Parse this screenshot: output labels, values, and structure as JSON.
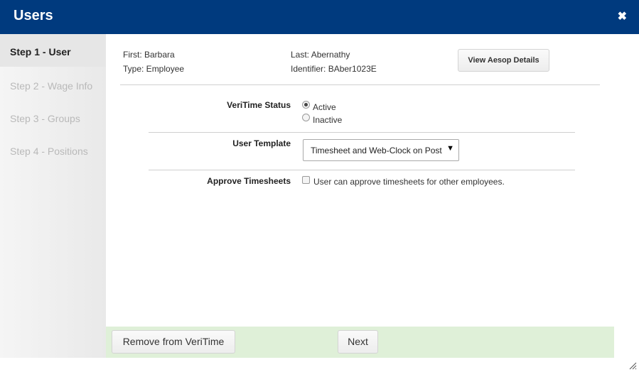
{
  "dialog": {
    "title": "Users",
    "close_icon": "close-icon",
    "close_glyph": "✖"
  },
  "steps": [
    {
      "label": "Step 1 - User",
      "active": true
    },
    {
      "label": "Step 2 - Wage Info",
      "active": false
    },
    {
      "label": "Step 3 - Groups",
      "active": false
    },
    {
      "label": "Step 4 - Positions",
      "active": false
    }
  ],
  "user_info": {
    "first": "First: Barbara",
    "last": "Last: Abernathy",
    "type": "Type: Employee",
    "identifier": "Identifier: BAber1023E"
  },
  "buttons": {
    "view_aesop": "View Aesop Details",
    "remove": "Remove from VeriTime",
    "next": "Next"
  },
  "form": {
    "veritime_status": {
      "label": "VeriTime Status",
      "options": [
        {
          "label": "Active",
          "selected": true
        },
        {
          "label": "Inactive",
          "selected": false
        }
      ]
    },
    "user_template": {
      "label": "User Template",
      "selected": "Timesheet and Web-Clock on Post",
      "arrow": "▼"
    },
    "approve_timesheets": {
      "label": "Approve Timesheets",
      "checkbox_label": "User can approve timesheets for other employees.",
      "checked": false
    }
  },
  "colors": {
    "titlebar": "#003a7e",
    "footer": "#dff0d8",
    "sidebar_active": "#e6e6e6"
  }
}
